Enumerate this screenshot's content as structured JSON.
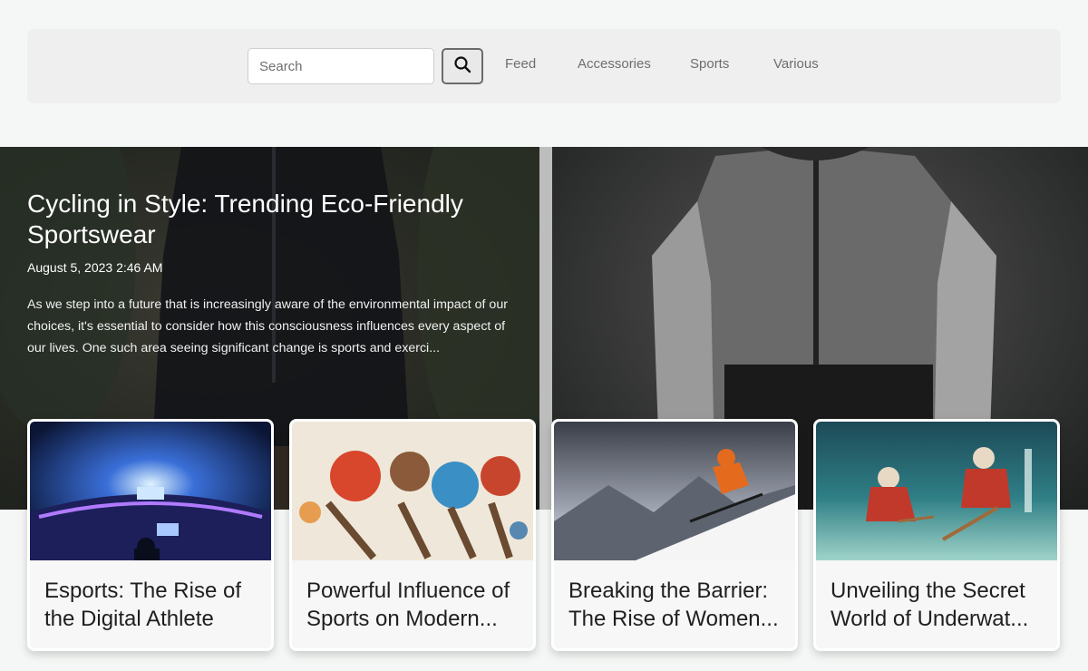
{
  "nav": {
    "search_placeholder": "Search",
    "links": [
      "Feed",
      "Accessories",
      "Sports",
      "Various"
    ]
  },
  "hero": {
    "title": "Cycling in Style: Trending Eco-Friendly Sportswear",
    "date": "August 5, 2023 2:46 AM",
    "excerpt": "As we step into a future that is increasingly aware of the environmental impact of our choices, it's essential to consider how this consciousness influences every aspect of our lives. One such area seeing significant change is sports and exerci..."
  },
  "cards": [
    {
      "title": "Esports: The Rise of the Digital Athlete",
      "image": "esports-arena-image"
    },
    {
      "title": "Powerful Influence of Sports on Modern...",
      "image": "football-painting-image"
    },
    {
      "title": "Breaking the Barrier: The Rise of Women...",
      "image": "skiing-image"
    },
    {
      "title": "Unveiling the Secret World of Underwat...",
      "image": "underwater-hockey-image"
    }
  ],
  "icons": {
    "search": "search-icon"
  },
  "colors": {
    "nav_bg": "#efefef",
    "page_bg": "#f5f7f6",
    "text": "#1f1f1f"
  }
}
